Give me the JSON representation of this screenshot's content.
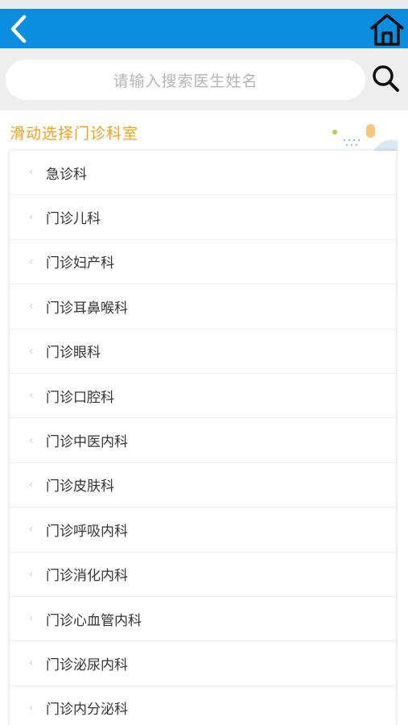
{
  "colors": {
    "header_bg": "#0d8de0",
    "accent": "#f5a21b",
    "text": "#333333",
    "placeholder": "#b5b5b5"
  },
  "header": {
    "back_icon": "back-chevron-icon",
    "home_icon": "home-icon"
  },
  "search": {
    "placeholder": "请输入搜索医生姓名",
    "icon": "search-icon"
  },
  "section": {
    "title": "滑动选择门诊科室"
  },
  "departments": [
    "急诊科",
    "门诊儿科",
    "门诊妇产科",
    "门诊耳鼻喉科",
    "门诊眼科",
    "门诊口腔科",
    "门诊中医内科",
    "门诊皮肤科",
    "门诊呼吸内科",
    "门诊消化内科",
    "门诊心血管内科",
    "门诊泌尿内科",
    "门诊内分泌科"
  ]
}
